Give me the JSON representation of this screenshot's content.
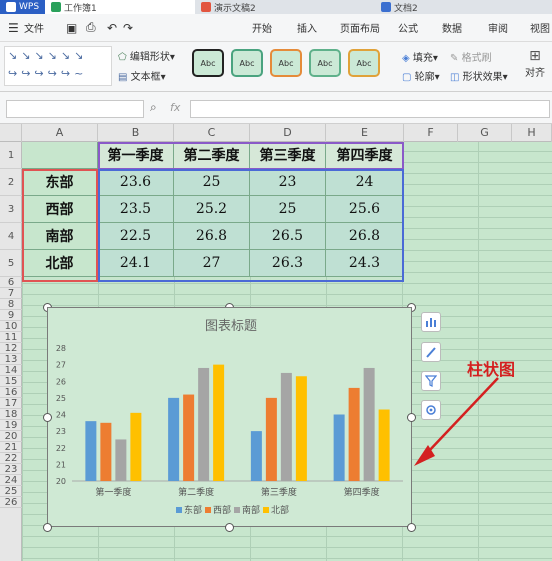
{
  "titlebar": {
    "tabs": [
      {
        "label": "WPS",
        "color": "#4a7fd6"
      },
      {
        "label": "工作簿1",
        "color": "#2aa15b"
      },
      {
        "label": "演示文稿2",
        "color": "#e2553f"
      },
      {
        "label": "文档2",
        "color": "#3b6fd0"
      }
    ]
  },
  "ribbon": {
    "file_menu": "文件",
    "tabs": [
      "开始",
      "插入",
      "页面布局",
      "公式",
      "数据",
      "审阅",
      "视图"
    ]
  },
  "toolbar": {
    "edit_shape": "编辑形状",
    "text_box": "文本框",
    "style_label": "Abc",
    "fill": "填充",
    "format_painter": "格式刷",
    "outline": "轮廓",
    "shape_effect": "形状效果",
    "align": "对齐",
    "style_box_borders": [
      "#222222",
      "#4aa37f",
      "#e58b3a",
      "#5fb18b",
      "#e0a23a"
    ]
  },
  "formulabar": {
    "fx": "fx",
    "name_value": "",
    "formula_value": ""
  },
  "sheet": {
    "columns": [
      "A",
      "B",
      "C",
      "D",
      "E",
      "F",
      "G",
      "H"
    ],
    "rows": [
      "1",
      "2",
      "3",
      "4",
      "5",
      "6",
      "7",
      "8",
      "9",
      "10",
      "11",
      "12",
      "13",
      "14",
      "15",
      "16",
      "17",
      "18",
      "19",
      "20",
      "21",
      "22",
      "23",
      "24",
      "25",
      "26"
    ],
    "header": [
      "第一季度",
      "第二季度",
      "第三季度",
      "第四季度"
    ],
    "data": [
      {
        "region": "东部",
        "values": [
          "23.6",
          "25",
          "23",
          "24"
        ]
      },
      {
        "region": "西部",
        "values": [
          "23.5",
          "25.2",
          "25",
          "25.6"
        ]
      },
      {
        "region": "南部",
        "values": [
          "22.5",
          "26.8",
          "26.5",
          "26.8"
        ]
      },
      {
        "region": "北部",
        "values": [
          "24.1",
          "27",
          "26.3",
          "24.3"
        ]
      }
    ]
  },
  "annotation": "柱状图",
  "chart_data": {
    "type": "bar",
    "title": "图表标题",
    "categories": [
      "第一季度",
      "第二季度",
      "第三季度",
      "第四季度"
    ],
    "series": [
      {
        "name": "东部",
        "values": [
          23.6,
          25,
          23,
          24
        ],
        "color": "#5b9bd5"
      },
      {
        "name": "西部",
        "values": [
          23.5,
          25.2,
          25,
          25.6
        ],
        "color": "#ed7d31"
      },
      {
        "name": "南部",
        "values": [
          22.5,
          26.8,
          26.5,
          26.8
        ],
        "color": "#a5a5a5"
      },
      {
        "name": "北部",
        "values": [
          24.1,
          27,
          26.3,
          24.3
        ],
        "color": "#ffc000"
      }
    ],
    "ylim": [
      20,
      28
    ],
    "yticks": [
      20,
      21,
      22,
      23,
      24,
      25,
      26,
      27,
      28
    ],
    "xlabel": "",
    "ylabel": "",
    "grid": false,
    "legend": "bottom"
  }
}
